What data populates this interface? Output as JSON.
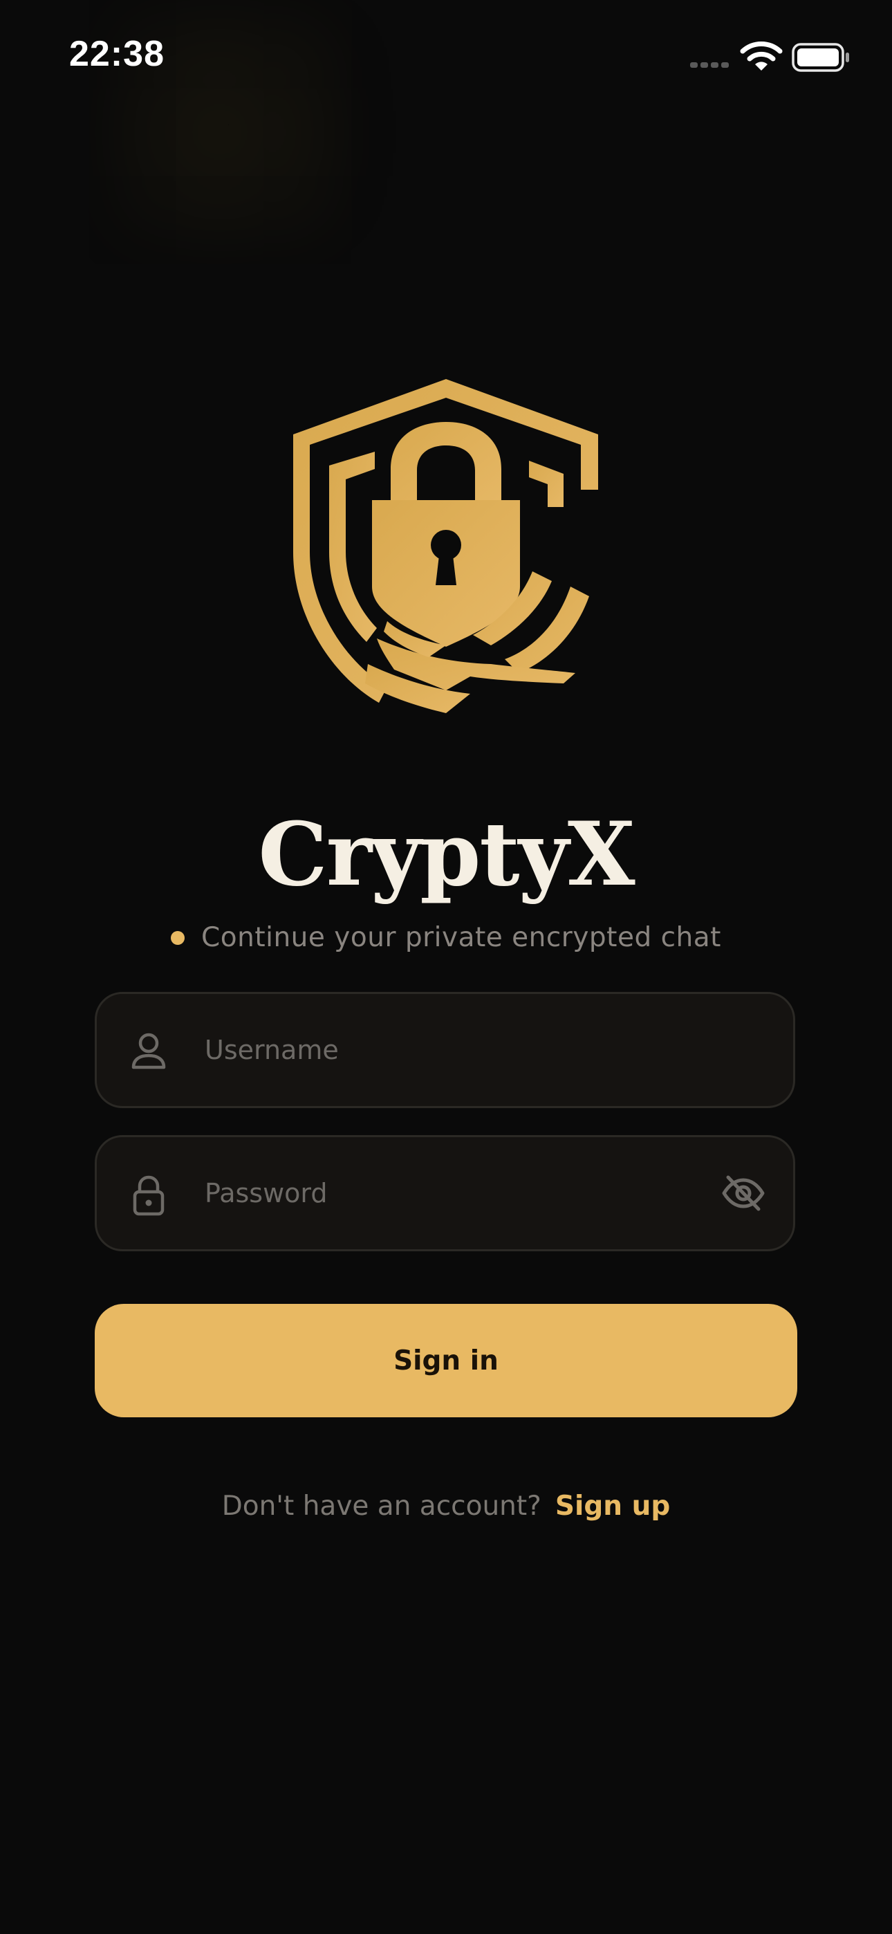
{
  "status_bar": {
    "time": "22:38",
    "icons": [
      "signal-icon",
      "wifi-icon",
      "battery-icon"
    ]
  },
  "logo": {
    "icon": "shield-lock-icon"
  },
  "app": {
    "title": "CryptyX",
    "subtitle": "Continue your private encrypted chat"
  },
  "form": {
    "username": {
      "placeholder": "Username",
      "value": "",
      "icon": "user-icon"
    },
    "password": {
      "placeholder": "Password",
      "value": "",
      "icon": "lock-icon",
      "toggle_icon": "eye-off-icon"
    },
    "signin_label": "Sign in"
  },
  "signup": {
    "prompt": "Don't have an account?",
    "link_label": "Sign up"
  },
  "colors": {
    "background": "#0a0a0a",
    "accent": "#e8b963",
    "title": "#f5efe3",
    "muted_text": "#8a8580",
    "field_background": "#151311",
    "field_border": "#2b2925"
  }
}
